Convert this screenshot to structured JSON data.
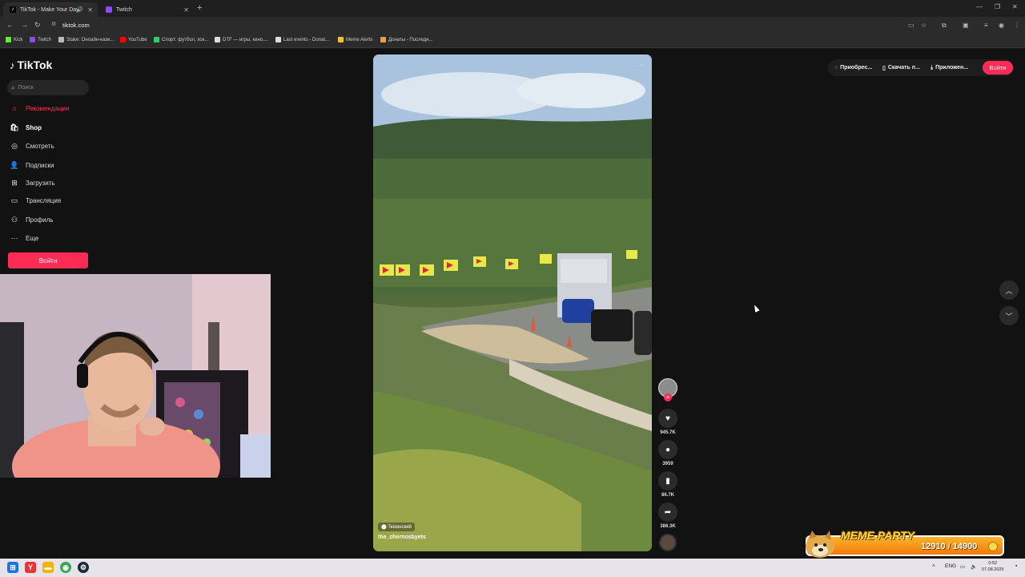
{
  "browser": {
    "tabs": [
      {
        "title": "TikTok - Make Your Day",
        "active": true
      },
      {
        "title": "Twitch",
        "active": false
      }
    ],
    "url": "tiktok.com",
    "bookmarks": [
      {
        "label": "Kick",
        "color": "#53fc18"
      },
      {
        "label": "Twitch",
        "color": "#9146ff"
      },
      {
        "label": "Stake: Онлайн-кази...",
        "color": "#bbbbbb"
      },
      {
        "label": "YouTube",
        "color": "#ff0000"
      },
      {
        "label": "Спорт: футбол, хок...",
        "color": "#2ecc71"
      },
      {
        "label": "DTF — игры, кино,...",
        "color": "#dddddd"
      },
      {
        "label": "Last events - Donat...",
        "color": "#dddddd"
      },
      {
        "label": "Meme Alerts",
        "color": "#f2c230"
      },
      {
        "label": "Донаты - Последн...",
        "color": "#f29d38"
      }
    ]
  },
  "tiktok": {
    "logo": "TikTok",
    "search_placeholder": "Поиск",
    "nav": [
      {
        "label": "Рекомендации",
        "icon": "home-icon"
      },
      {
        "label": "Shop",
        "icon": "shop-icon"
      },
      {
        "label": "Смотреть",
        "icon": "explore-icon"
      },
      {
        "label": "Подписки",
        "icon": "following-icon"
      },
      {
        "label": "Загрузить",
        "icon": "upload-icon"
      },
      {
        "label": "Трансляция",
        "icon": "live-icon"
      },
      {
        "label": "Профиль",
        "icon": "profile-icon"
      },
      {
        "label": "Еще",
        "icon": "more-icon"
      }
    ],
    "login_label": "Войти",
    "top_actions": [
      {
        "label": "Приобрес...",
        "icon": "coin-icon"
      },
      {
        "label": "Скачать п...",
        "icon": "phone-icon"
      },
      {
        "label": "Приложен...",
        "icon": "download-icon"
      }
    ],
    "top_login_label": "Войти",
    "video": {
      "location": "Тюкинский",
      "author": "the_chernosbyets"
    },
    "actions": {
      "likes": "945.7K",
      "comments": "3959",
      "saves": "86.7K",
      "shares": "386.3K"
    }
  },
  "widget": {
    "title": "MEME PARTY",
    "progress": "12910 / 14900",
    "progress_value": 0.866
  },
  "taskbar": {
    "lang": "ENG",
    "time": "0:52",
    "date": "07.08.2025"
  },
  "colors": {
    "brand": "#fe2c55",
    "background": "#121212"
  }
}
